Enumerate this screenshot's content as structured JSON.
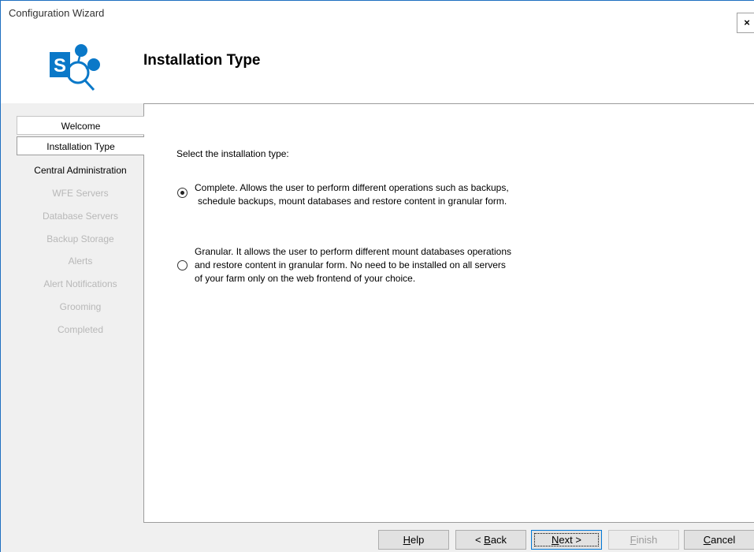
{
  "window": {
    "title": "Configuration Wizard",
    "close_label": "×"
  },
  "header": {
    "page_title": "Installation Type",
    "logo_icon": "sharepoint-logo-icon",
    "logo_letter": "S"
  },
  "nav": {
    "items": [
      {
        "label": "Welcome",
        "state": "visited"
      },
      {
        "label": "Installation Type",
        "state": "active"
      },
      {
        "label": "Central Administration",
        "state": "enabled"
      },
      {
        "label": "WFE Servers",
        "state": "disabled"
      },
      {
        "label": "Database Servers",
        "state": "disabled"
      },
      {
        "label": "Backup Storage",
        "state": "disabled"
      },
      {
        "label": "Alerts",
        "state": "disabled"
      },
      {
        "label": "Alert Notifications",
        "state": "disabled"
      },
      {
        "label": "Grooming",
        "state": "disabled"
      },
      {
        "label": "Completed",
        "state": "disabled"
      }
    ]
  },
  "content": {
    "prompt": "Select the installation type:",
    "options": [
      {
        "lines": [
          "Complete. Allows the user to perform different operations such as backups,",
          "schedule backups, mount databases and restore content in granular form."
        ],
        "selected": true
      },
      {
        "lines": [
          "Granular. It allows the user to perform different mount databases operations",
          "and restore content in granular form. No need to be installed on all servers",
          "of your farm only on the web frontend of your choice."
        ],
        "selected": false
      }
    ]
  },
  "buttons": {
    "help": {
      "mnemonic": "H",
      "rest": "elp"
    },
    "back": {
      "prefix": "< ",
      "mnemonic": "B",
      "rest": "ack"
    },
    "next": {
      "mnemonic": "N",
      "rest": "ext >"
    },
    "finish": {
      "mnemonic": "F",
      "rest": "inish"
    },
    "cancel": {
      "mnemonic": "C",
      "rest": "ancel"
    }
  },
  "colors": {
    "window_border": "#1e6fc0",
    "logo_blue": "#0a78c8",
    "disabled_text": "#b8b8b8"
  }
}
